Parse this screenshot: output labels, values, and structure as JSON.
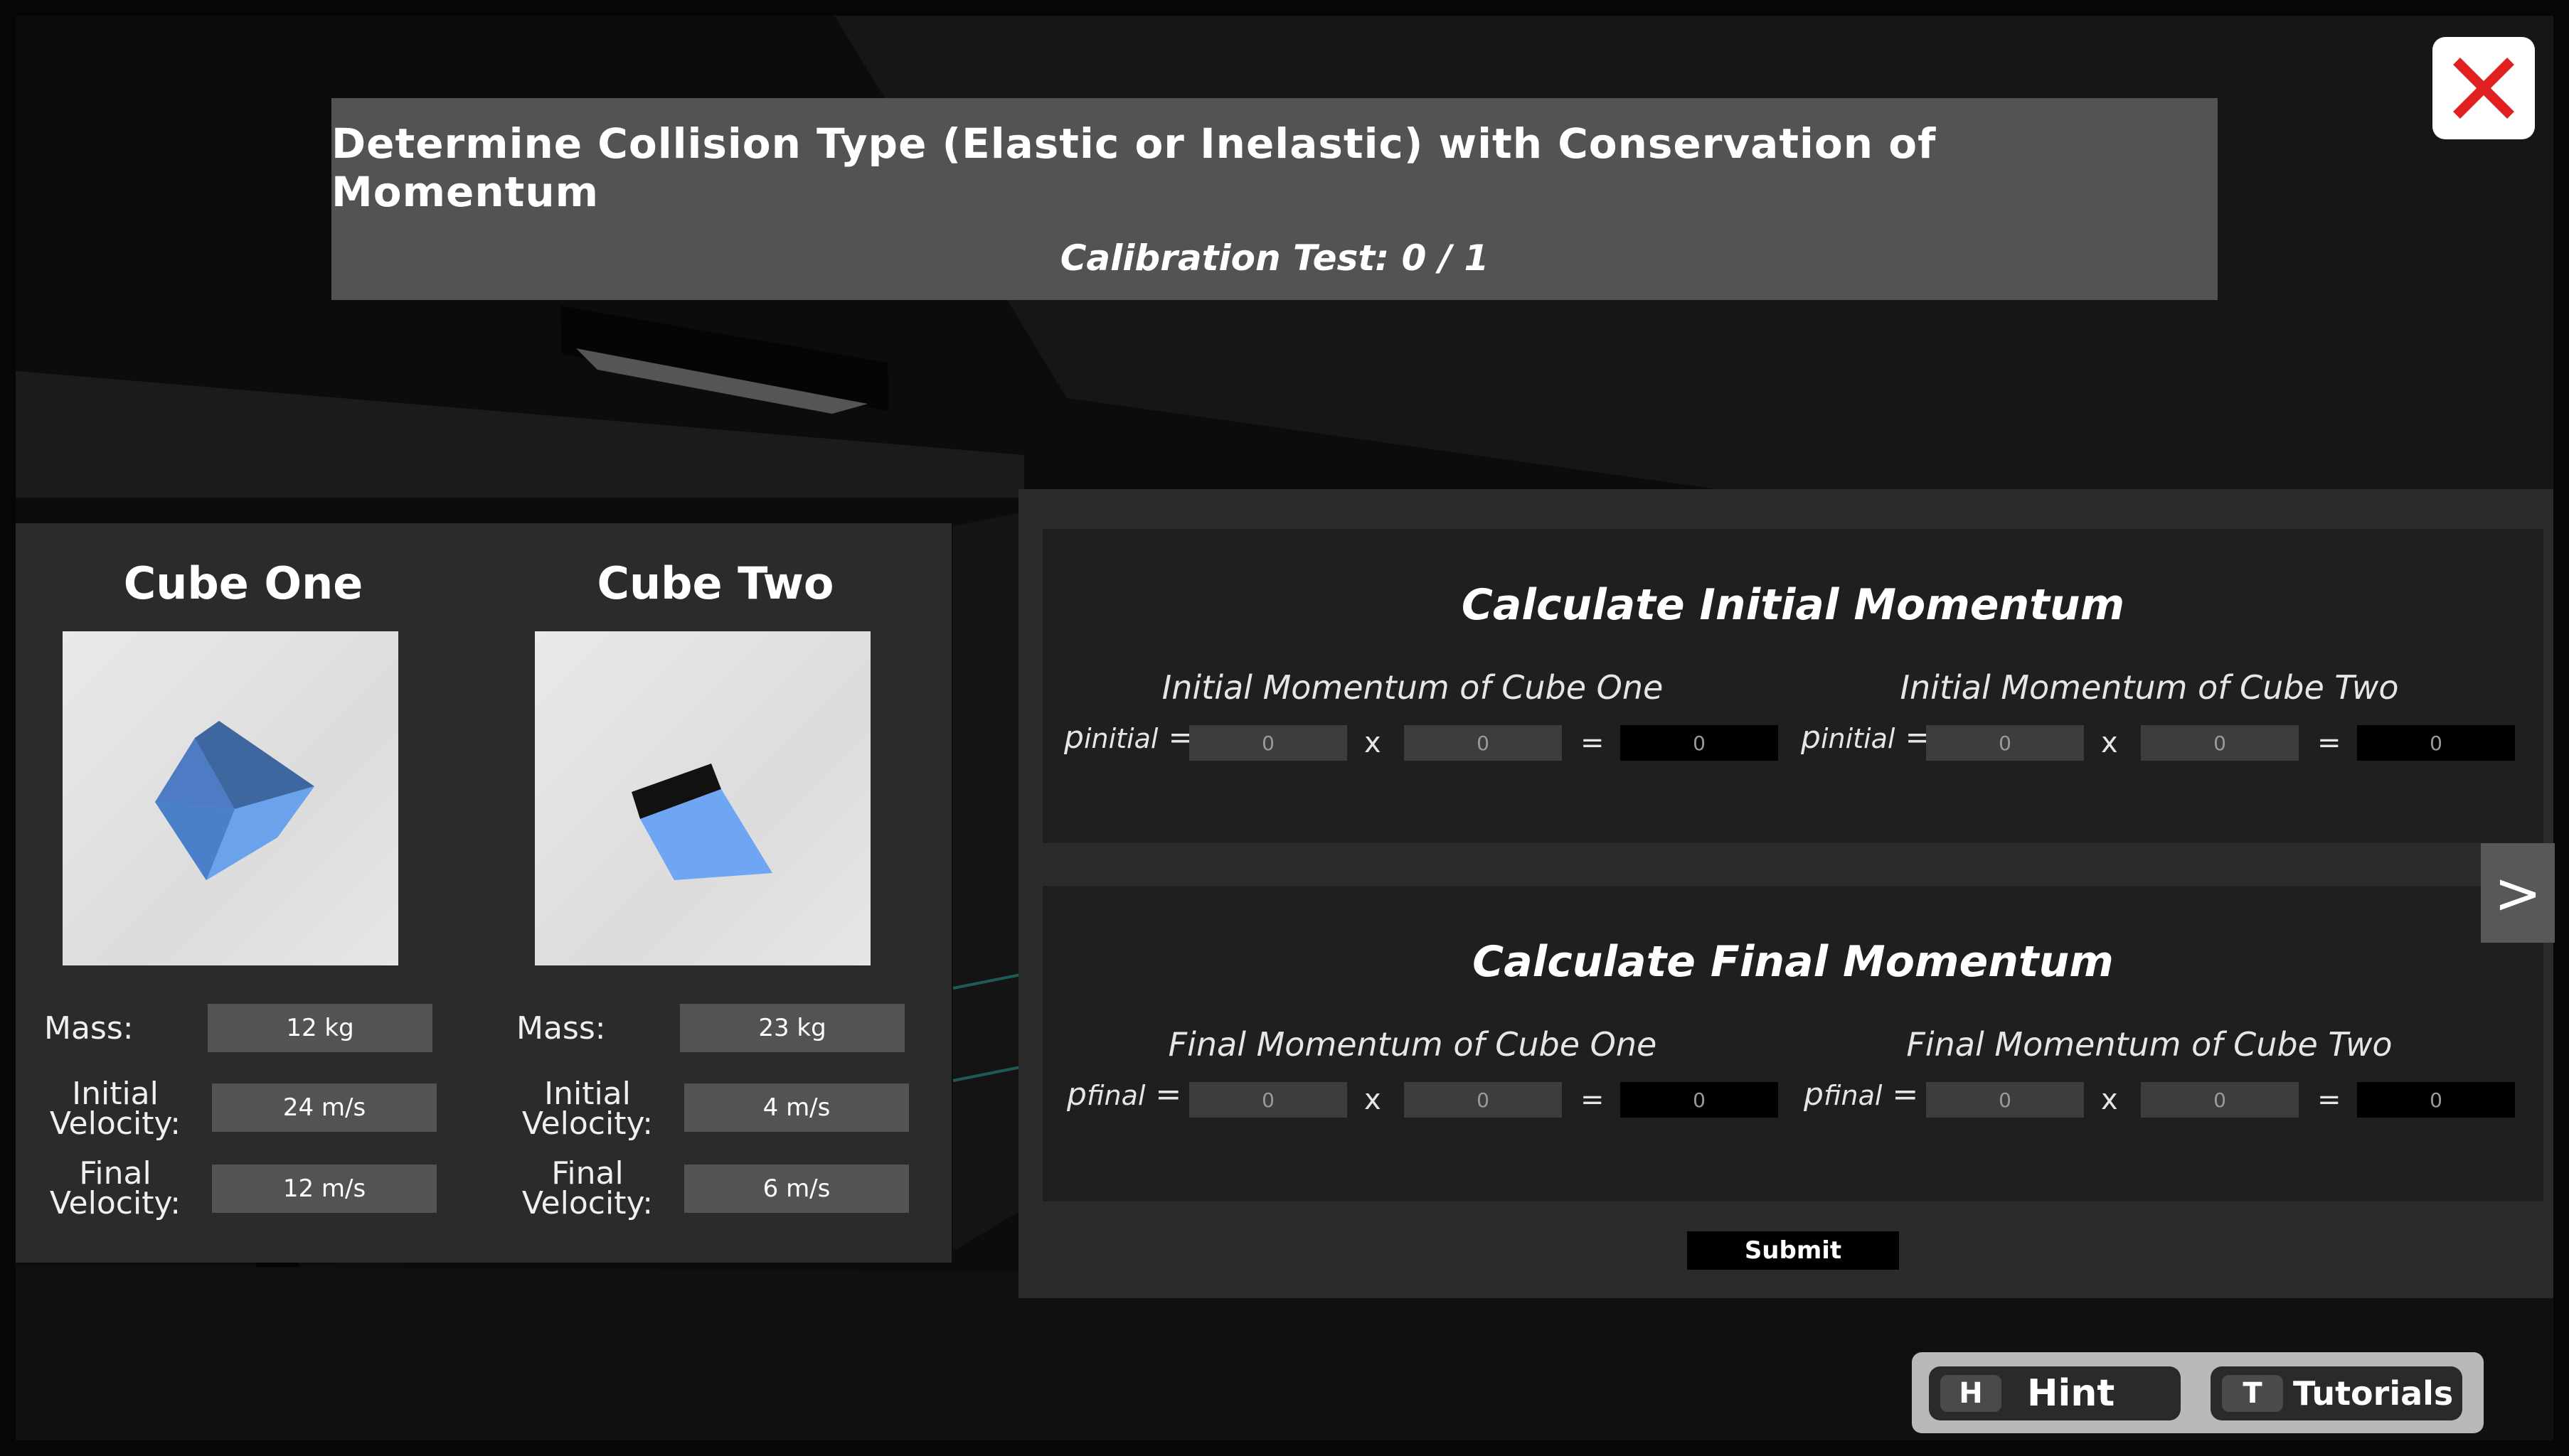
{
  "header": {
    "title": "Determine Collision Type (Elastic or Inelastic) with Conservation of Momentum",
    "subtitle": "Calibration Test: 0 / 1"
  },
  "cubes": [
    {
      "name": "Cube One",
      "color": "#4d7cc4",
      "mass_label": "Mass:",
      "mass": "12 kg",
      "initial_label_1": "Initial",
      "initial_label_2": "Velocity:",
      "initial_velocity": "24 m/s",
      "final_label_1": "Final",
      "final_label_2": "Velocity:",
      "final_velocity": "12 m/s"
    },
    {
      "name": "Cube Two",
      "color": "#6fa6f4",
      "mass_label": "Mass:",
      "mass": "23 kg",
      "initial_label_1": "Initial",
      "initial_label_2": "Velocity:",
      "initial_velocity": "4 m/s",
      "final_label_1": "Final",
      "final_label_2": "Velocity:",
      "final_velocity": "6 m/s"
    }
  ],
  "initial": {
    "title": "Calculate Initial Momentum",
    "cube_one_label": "Initial Momentum of Cube One",
    "cube_two_label": "Initial Momentum of Cube Two",
    "p_symbol": "p",
    "p_sub": "initial",
    "equals": "=",
    "times": "x",
    "values": [
      "0",
      "0",
      "0",
      "0",
      "0",
      "0"
    ]
  },
  "final": {
    "title": "Calculate Final Momentum",
    "cube_one_label": "Final Momentum of Cube One",
    "cube_two_label": "Final Momentum of Cube Two",
    "p_symbol": "p",
    "p_sub": "final",
    "equals": "=",
    "times": "x",
    "values": [
      "0",
      "0",
      "0",
      "0",
      "0",
      "0"
    ]
  },
  "submit_label": "Submit",
  "next_label": ">",
  "hints": {
    "hint_key": "H",
    "hint_label": "Hint",
    "tutorial_key": "T",
    "tutorial_label": "Tutorials"
  },
  "colors": {
    "close_x": "#e02020",
    "panel": "#2b2b2b",
    "calc_box": "#1f1f1f"
  }
}
